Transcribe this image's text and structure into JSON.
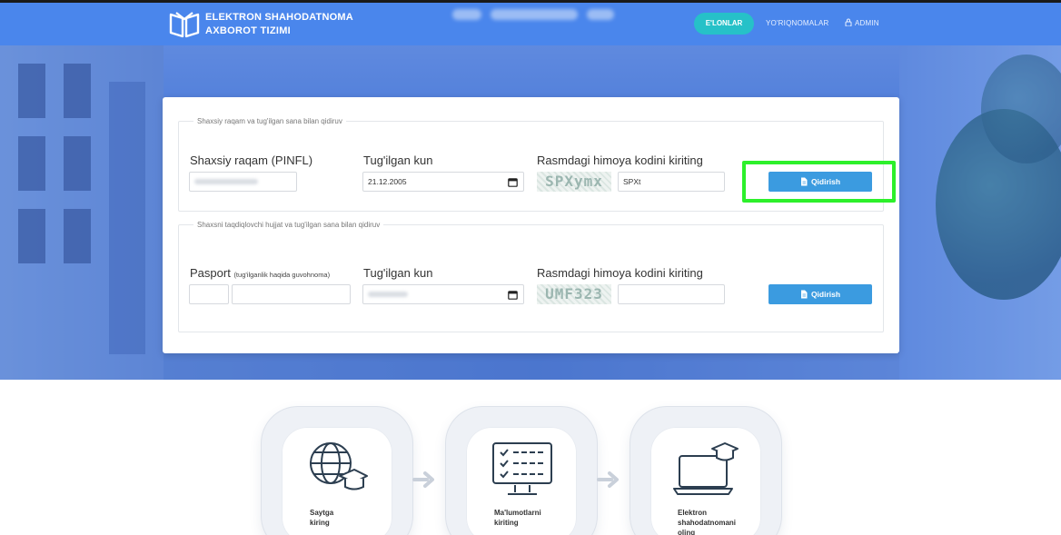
{
  "header": {
    "brand_line1": "ELEKTRON SHAHODATNOMA",
    "brand_line2": "AXBOROT TIZIMI",
    "nav": {
      "active_label": "E'LONLAR",
      "link_guides": "YO'RIQNOMALAR",
      "link_admin": "ADMIN"
    },
    "logo_icon": "open-book-icon",
    "admin_icon": "lock-icon"
  },
  "search_by_pinfl": {
    "legend": "Shaxsiy raqam va tug'ilgan sana bilan qidiruv",
    "pinfl_label": "Shaxsiy raqam (PINFL)",
    "birthdate_label": "Tug'ilgan kun",
    "birthdate_value": "21.12.2005",
    "captcha_label": "Rasmdagi himoya kodini kiriting",
    "captcha_image_text": "SPXymx",
    "captcha_input_value": "SPXt",
    "search_button": "Qidirish"
  },
  "search_by_document": {
    "legend": "Shaxsni taqdiqlovchi hujjat va tug'ilgan sana bilan qidiruv",
    "passport_label": "Pasport",
    "passport_hint": "(tug'ilganlik haqida guvohnoma)",
    "birthdate_label": "Tug'ilgan kun",
    "captcha_label": "Rasmdagi himoya kodini kiriting",
    "captcha_image_text": "UMF323",
    "search_button": "Qidirish"
  },
  "steps": [
    {
      "label_line1": "Saytga",
      "label_line2": "kiring",
      "icon": "globe-graduation-icon"
    },
    {
      "label_line1": "Ma'lumotlarni",
      "label_line2": "kiriting",
      "icon": "checklist-monitor-icon"
    },
    {
      "label_line1": "Elektron shahodatnomani",
      "label_line2": "oling",
      "icon": "laptop-graduation-icon"
    }
  ],
  "colors": {
    "header_bg": "#4a86ec",
    "active_pill": "#26c1c8",
    "button": "#3b9be0",
    "highlight": "#2df02b"
  }
}
